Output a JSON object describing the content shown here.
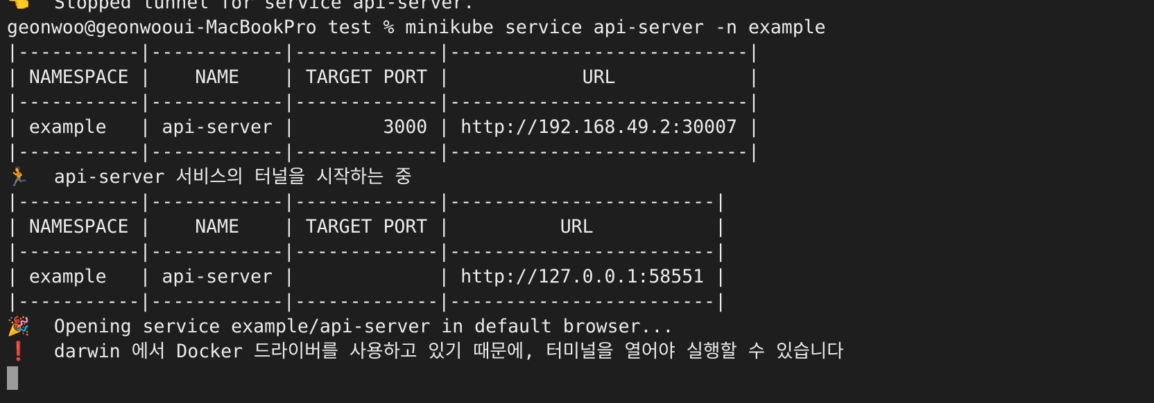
{
  "terminal": {
    "lines": [
      {
        "prefix": "👈",
        "text": "  Stopped tunnel for service api-server."
      },
      {
        "prefix": "",
        "text": "geonwoo@geonwooui-MacBookPro test % minikube service api-server -n example"
      },
      {
        "prefix": "",
        "text": "|-----------|------------|-------------|---------------------------|"
      },
      {
        "prefix": "",
        "text": "| NAMESPACE |    NAME    | TARGET PORT |            URL            |"
      },
      {
        "prefix": "",
        "text": "|-----------|------------|-------------|---------------------------|"
      },
      {
        "prefix": "",
        "text": "| example   | api-server |        3000 | http://192.168.49.2:30007 |"
      },
      {
        "prefix": "",
        "text": "|-----------|------------|-------------|---------------------------|"
      },
      {
        "prefix": "🏃",
        "text": "  api-server 서비스의 터널을 시작하는 중"
      },
      {
        "prefix": "",
        "text": "|-----------|------------|-------------|------------------------|"
      },
      {
        "prefix": "",
        "text": "| NAMESPACE |    NAME    | TARGET PORT |          URL           |"
      },
      {
        "prefix": "",
        "text": "|-----------|------------|-------------|------------------------|"
      },
      {
        "prefix": "",
        "text": "| example   | api-server |             | http://127.0.0.1:58551 |"
      },
      {
        "prefix": "",
        "text": "|-----------|------------|-------------|------------------------|"
      },
      {
        "prefix": "🎉",
        "text": "  Opening service example/api-server in default browser..."
      },
      {
        "prefix": "❗",
        "text": "  darwin 에서 Docker 드라이버를 사용하고 있기 때문에, 터미널을 열어야 실행할 수 있습니다"
      }
    ]
  },
  "colors": {
    "background": "#1e1e1e",
    "foreground": "#ececec",
    "cursor": "#9c9c9c",
    "warning": "#e02a2a"
  }
}
